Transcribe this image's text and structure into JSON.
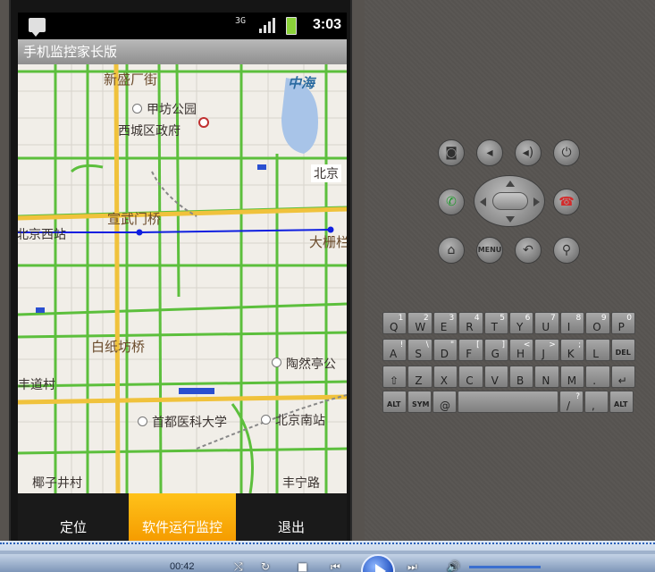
{
  "status_bar": {
    "network": "3G",
    "time": "3:03"
  },
  "app": {
    "title": "手机监控家长版"
  },
  "map": {
    "labels": [
      "新盛厂街",
      "中海",
      "甲坊公园",
      "西城区政府",
      "北京",
      "宣武门桥",
      "大栅栏",
      "北京西站",
      "白纸坊桥",
      "陶然亭公",
      "丰道村",
      "首都医科大学",
      "北京南站",
      "椰子井村",
      "丰宁路"
    ]
  },
  "bottom_menu": {
    "locate": "定位",
    "monitor": "软件运行监控",
    "exit": "退出"
  },
  "emulator": {
    "menu_label": "MENU",
    "keyboard": [
      [
        [
          "Q",
          "1"
        ],
        [
          "W",
          "2"
        ],
        [
          "E",
          "3"
        ],
        [
          "R",
          "4"
        ],
        [
          "T",
          "5"
        ],
        [
          "Y",
          "6"
        ],
        [
          "U",
          "7"
        ],
        [
          "I",
          "8"
        ],
        [
          "O",
          "9"
        ],
        [
          "P",
          "0"
        ]
      ],
      [
        [
          "A",
          "!"
        ],
        [
          "S",
          "\\"
        ],
        [
          "D",
          "\""
        ],
        [
          "F",
          "["
        ],
        [
          "G",
          "]"
        ],
        [
          "H",
          "<"
        ],
        [
          "J",
          ">"
        ],
        [
          "K",
          ";"
        ],
        [
          "L",
          ""
        ],
        [
          "DEL",
          ""
        ]
      ],
      [
        [
          "⇧",
          ""
        ],
        [
          "Z",
          ""
        ],
        [
          "X",
          ""
        ],
        [
          "C",
          ""
        ],
        [
          "V",
          ""
        ],
        [
          "B",
          ""
        ],
        [
          "N",
          ""
        ],
        [
          "M",
          ""
        ],
        [
          ".",
          ""
        ],
        [
          "↵",
          ""
        ]
      ],
      [
        [
          "ALT",
          ""
        ],
        [
          "SYM",
          ""
        ],
        [
          "@",
          ""
        ],
        [
          "",
          ""
        ],
        [
          "/",
          "?"
        ],
        [
          ",",
          ""
        ],
        [
          "ALT",
          ""
        ]
      ]
    ]
  },
  "taskbar": {
    "elapsed": "00:42"
  }
}
